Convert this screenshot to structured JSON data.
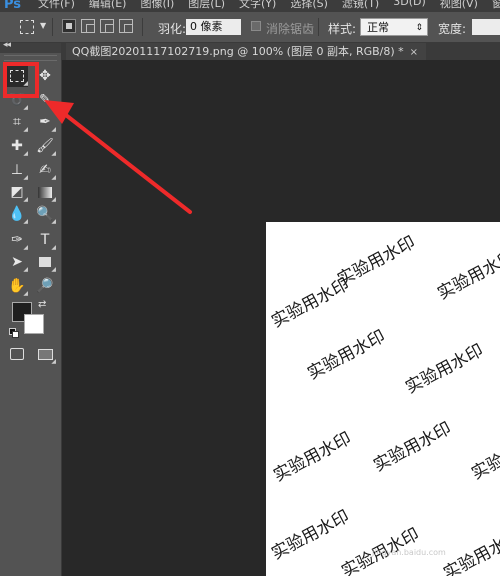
{
  "app": {
    "logo": "Ps",
    "menus": [
      "文件(F)",
      "编辑(E)",
      "图像(I)",
      "图层(L)",
      "文字(Y)",
      "选择(S)",
      "滤镜(T)",
      "3D(D)",
      "视图(V)",
      "窗口(W)"
    ]
  },
  "options": {
    "feather_label": "羽化:",
    "feather_value": "0 像素",
    "antialias_label": "消除锯齿",
    "style_label": "样式:",
    "style_value": "正常",
    "width_label": "宽度:"
  },
  "panel": {
    "collapse": "◂◂"
  },
  "document": {
    "tab_title": "QQ截图20201117102719.png @ 100% (图层 0 副本, RGB/8) *",
    "close": "×"
  },
  "canvas": {
    "watermark_text": "实验用水印"
  },
  "footer_watermark": "jingyan.baidu.com",
  "colors": {
    "highlight": "#ee2a2a",
    "foreground": "#1f1f1f",
    "background": "#ffffff"
  }
}
